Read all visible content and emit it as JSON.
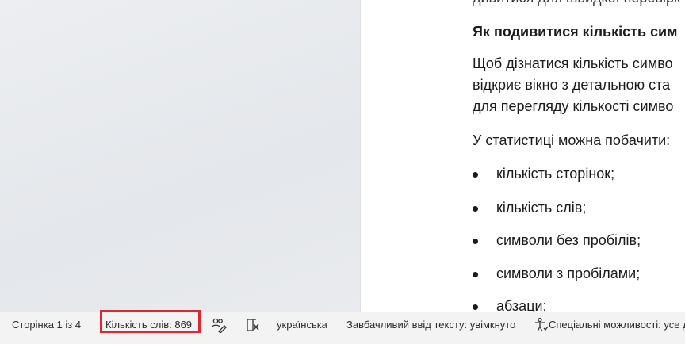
{
  "document": {
    "top_fragment": "дивитися для швидкої перевірк",
    "heading": "Як подивитися кількість сим",
    "para_lines": [
      "Щоб дізнатися кількість симво",
      "відкриє вікно з детальною ста",
      "для перегляду кількості симво"
    ],
    "stats_intro": "У статистиці можна побачити:",
    "bullets": [
      "кількість сторінок;",
      "кількість слів;",
      "символи без пробілів;",
      "символи з пробілами;",
      "абзаци;"
    ]
  },
  "statusbar": {
    "page_info": "Сторінка 1 із 4",
    "word_count": "Кількість слів: 869",
    "language": "українська",
    "predictive_text": "Завбачливий ввід тексту: увімкнуто",
    "accessibility": "Спеціальні можливості: усе д"
  },
  "icons": {
    "proofing": "proofing-people-pen-icon",
    "text_predictions": "text-predictions-icon",
    "accessibility": "accessibility-person-icon"
  },
  "colors": {
    "highlight_border": "#e0272f"
  }
}
